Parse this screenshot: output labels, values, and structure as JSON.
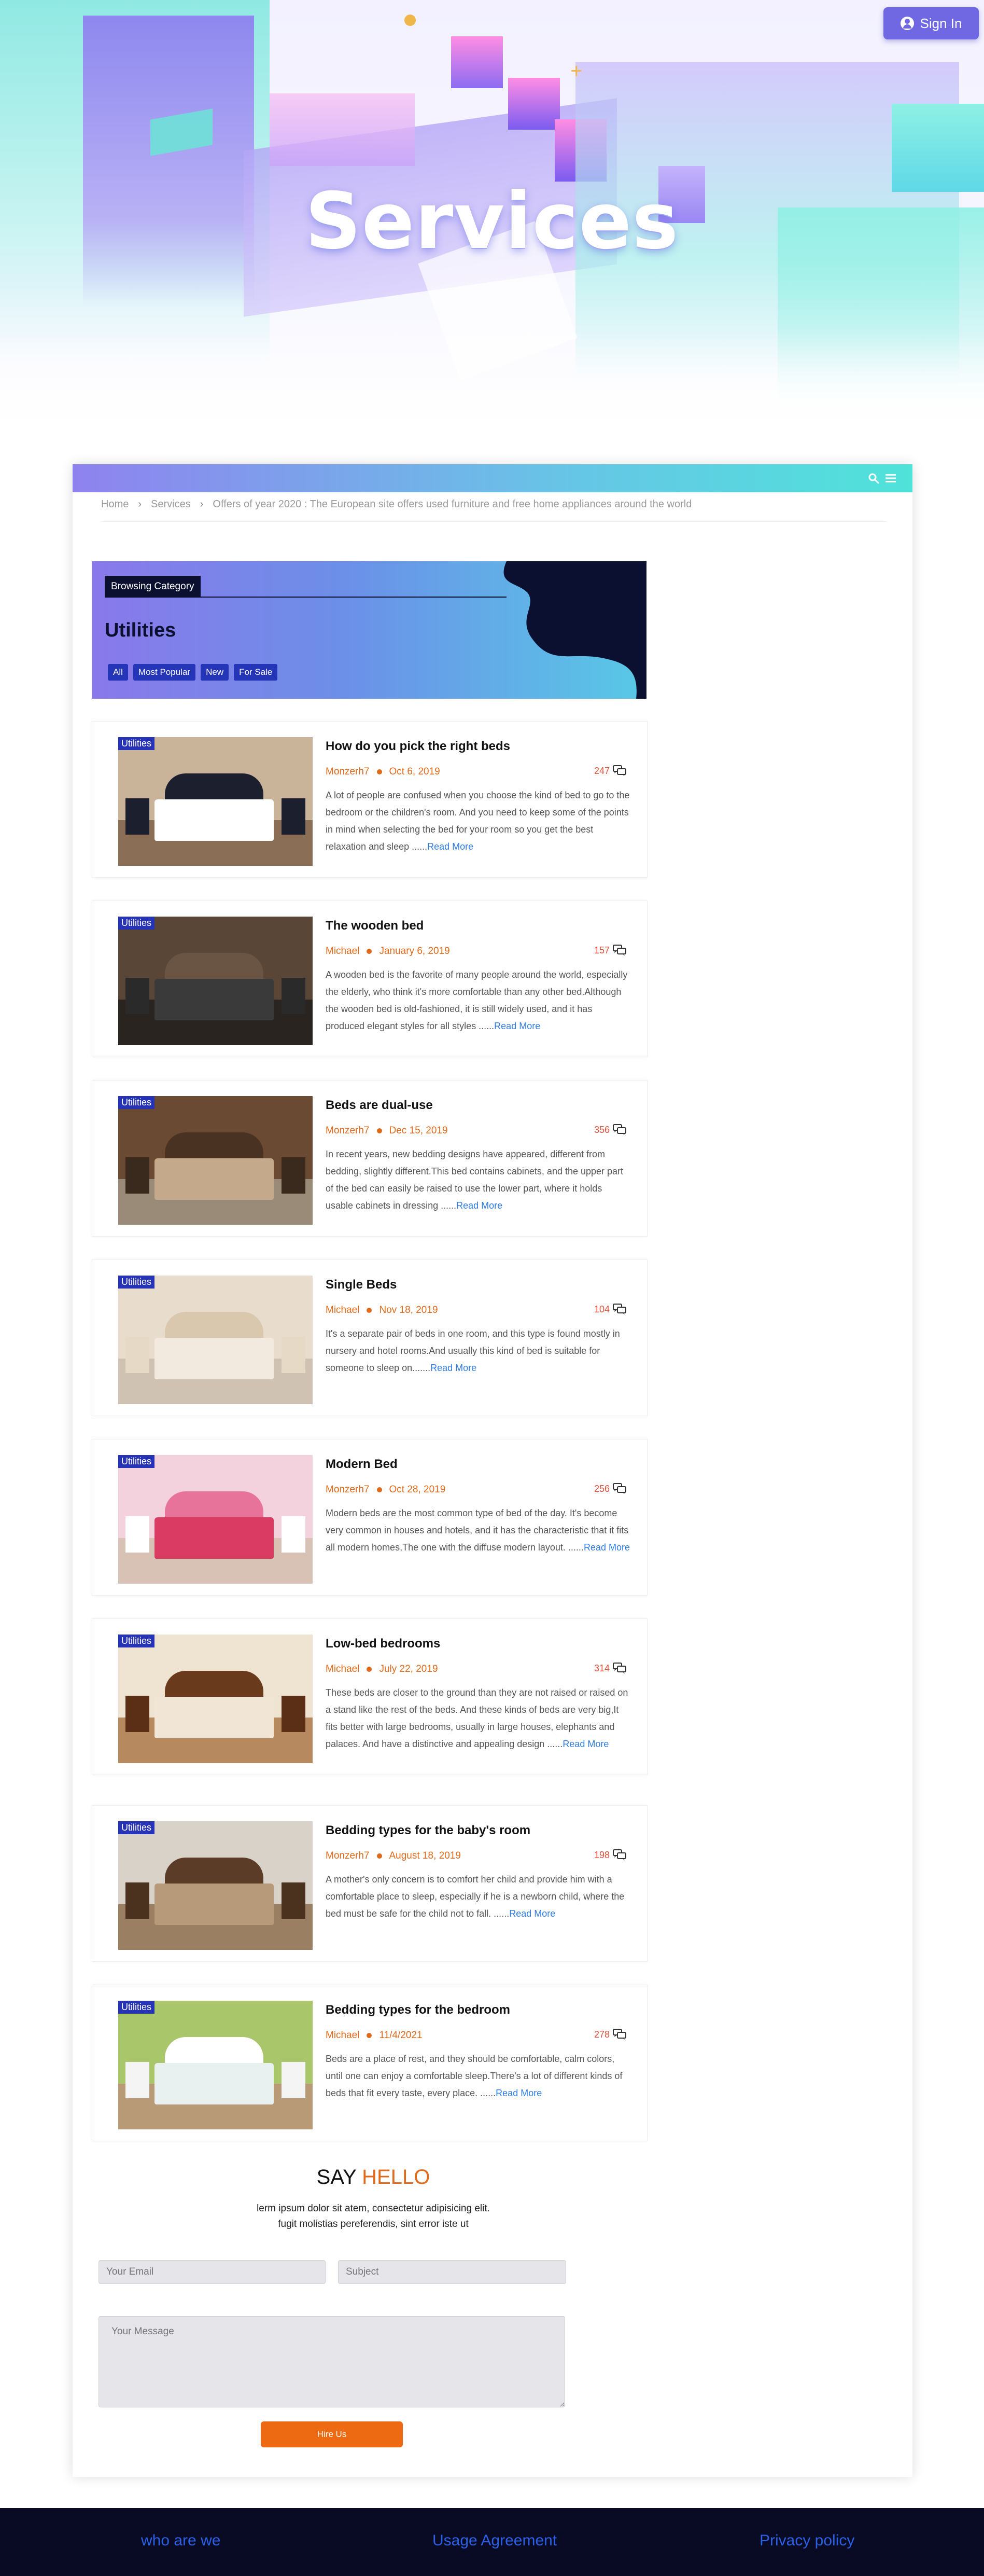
{
  "hero": {
    "title": "Services",
    "signin_label": "Sign In"
  },
  "navbar": {
    "search_icon": "search-icon",
    "menu_icon": "hamburger-menu-icon"
  },
  "breadcrumb": [
    "Home",
    "Services",
    "Offers of year 2020 : The European site offers used furniture and free home appliances around the world"
  ],
  "category": {
    "browse_label": "Browsing Category",
    "title": "Utilities",
    "filters": [
      "All",
      "Most Popular",
      "New",
      "For Sale"
    ]
  },
  "posts": [
    {
      "tag": "Utilities",
      "title": "How do you pick the right beds",
      "author": "Monzerh7",
      "date": "Oct 6, 2019",
      "comments": "247",
      "desc": "A lot of people are confused when you choose the kind of bed to go to the bedroom or the children's room. And you need to keep some of the points in mind when selecting the bed for your room so you get the best relaxation and sleep ......",
      "more": "Read More"
    },
    {
      "tag": "Utilities",
      "title": "The wooden bed",
      "author": "Michael",
      "date": "January 6, 2019",
      "comments": "157",
      "desc": "A wooden bed is the favorite of many people around the world, especially the elderly, who think it's more comfortable than any other bed.Although the wooden bed is old-fashioned, it is still widely used, and it has produced elegant styles for all styles ......",
      "more": "Read More"
    },
    {
      "tag": "Utilities",
      "title": "Beds are dual-use",
      "author": "Monzerh7",
      "date": "Dec 15, 2019",
      "comments": "356",
      "desc": "In recent years, new bedding designs have appeared, different from bedding, slightly different.This bed contains cabinets, and the upper part of the bed can easily be raised to use the lower part, where it holds usable cabinets in dressing ......",
      "more": "Read More"
    },
    {
      "tag": "Utilities",
      "title": "Single Beds",
      "author": "Michael",
      "date": "Nov 18, 2019",
      "comments": "104",
      "desc": "It's a separate pair of beds in one room, and this type is found mostly in nursery and hotel rooms.And usually this kind of bed is suitable for someone to sleep on.......",
      "more": "Read More"
    },
    {
      "tag": "Utilities",
      "title": "Modern Bed",
      "author": "Monzerh7",
      "date": "Oct 28, 2019",
      "comments": "256",
      "desc": "Modern beds are the most common type of bed of the day. It's become very common in houses and hotels, and it has the characteristic that it fits all modern homes,The one with the diffuse modern layout. ......",
      "more": "Read More"
    },
    {
      "tag": "Utilities",
      "title": "Low-bed bedrooms",
      "author": "Michael",
      "date": "July 22, 2019",
      "comments": "314",
      "desc": "These beds are closer to the ground than they are not raised or raised on a stand like the rest of the beds. And these kinds of beds are very big,It fits better with large bedrooms, usually in large houses, elephants and palaces. And have a distinctive and appealing design ......",
      "more": "Read More"
    },
    {
      "tag": "Utilities",
      "title": "Bedding types for the baby's room",
      "author": "Monzerh7",
      "date": "August 18, 2019",
      "comments": "198",
      "desc": "A mother's only concern is to comfort her child and provide him with a comfortable place to sleep, especially if he is a newborn child, where the bed must be safe for the child not to fall. ......",
      "more": "Read More"
    },
    {
      "tag": "Utilities",
      "title": "Bedding types for the bedroom",
      "author": "Michael",
      "date": "11/4/2021",
      "comments": "278",
      "desc": "Beds are a place of rest, and they should be comfortable, calm colors, until one can enjoy a comfortable sleep.There's a lot of different kinds of beds that fit every taste, every place. ......",
      "more": "Read More"
    }
  ],
  "contact": {
    "title_a": "SAY",
    "title_b": "HELLO",
    "line1": "lerm ipsum dolor sit atem, consectetur adipisicing elit.",
    "line2": "fugit molistias pereferendis, sint error iste ut",
    "email_placeholder": "Your Email",
    "subject_placeholder": "Subject",
    "message_placeholder": "Your Message",
    "submit_label": "Hire Us"
  },
  "footer": {
    "links": [
      "who are we",
      "Usage Agreement",
      "Privacy policy"
    ]
  },
  "colors": {
    "accent_orange": "#e26a1c",
    "tag_blue": "#2633b6",
    "link_blue": "#2f7de0",
    "footer_bg": "#080b23",
    "signin_bg": "#6f68e2"
  }
}
